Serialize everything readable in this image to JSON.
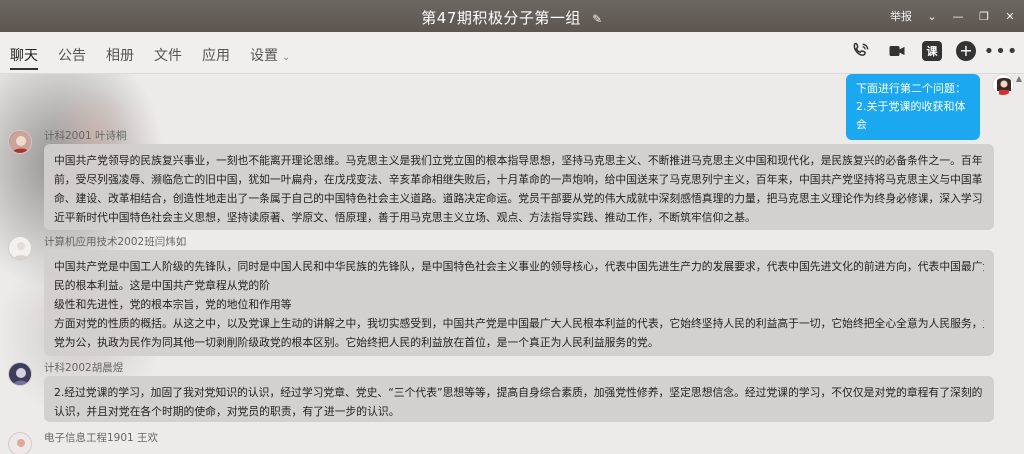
{
  "window": {
    "title": "第47期积极分子第一组",
    "report_label": "举报"
  },
  "tabs": [
    {
      "label": "聊天"
    },
    {
      "label": "公告"
    },
    {
      "label": "相册"
    },
    {
      "label": "文件"
    },
    {
      "label": "应用"
    },
    {
      "label": "设置"
    }
  ],
  "toolbar_icons": {
    "call": "phone-icon",
    "video": "video-camera-icon",
    "course": "课",
    "add": "+",
    "more": "more-icon"
  },
  "colors": {
    "titlebar": "#625b55",
    "bubble_mine": "#1ba8f0",
    "bubble_other": "#d2d0ce"
  },
  "my_message": {
    "lines": [
      "下面进行第二个问题：",
      "2.关于党课的收获和体会"
    ]
  },
  "messages": [
    {
      "sender": "计科2001 叶诗桐",
      "lines": [
        "中国共产党领导的民族复兴事业，一刻也不能离开理论思维。马克思主义是我们立党立国的根本指导思想，坚持马克思主义、不断推进马克思主义中国和现代化，是民族复兴的必备条件之一。百年",
        "前，受尽列强凌辱、濒临危亡的旧中国，犹如一叶扁舟，在戊戌变法、辛亥革命相继失败后，十月革命的一声炮响，给中国送来了马克思列宁主义，百年来，中国共产党坚持将马克思主义与中国革",
        "命、建设、改革相结合，创造性地走出了一条属于自己的中国特色社会主义道路。道路决定命运。党员干部要从党的伟大成就中深刻感悟真理的力量，把马克思主义理论作为终身必修课，深入学习习",
        "近平新时代中国特色社会主义思想，坚持读原著、学原文、悟原理，善于用马克思主义立场、观点、方法指导实践、推动工作，不断筑牢信仰之基。"
      ]
    },
    {
      "sender": "计算机应用技术2002班闫炜如",
      "lines": [
        "中国共产党是中国工人阶级的先锋队，同时是中国人民和中华民族的先锋队，是中国特色社会主义事业的领导核心，代表中国先进生产力的发展要求，代表中国先进文化的前进方向，代表中国最广大人",
        "民的根本利益。这是中国共产党章程从党的阶",
        "级性和先进性，党的根本宗旨，党的地位和作用等",
        "方面对党的性质的概括。从这之中，以及党课上生动的讲解之中，我切实感受到，中国共产党是中国最广大人民根本利益的代表，它始终坚持人民的利益高于一切，它始终把全心全意为人民服务，立",
        "党为公，执政为民作为同其他一切剥削阶级政党的根本区别。它始终把人民的利益放在首位，是一个真正为人民利益服务的党。"
      ]
    },
    {
      "sender": "计科2002胡晨煜",
      "lines": [
        "2.经过党课的学习，加固了我对党知识的认识，经过学习党章、党史、“三个代表”思想等等，提高自身综合素质，加强党性修养，坚定思想信念。经过党课的学习，不仅仅是对党的章程有了深刻的",
        "认识，并且对党在各个时期的使命，对党员的职责，有了进一步的认识。"
      ]
    },
    {
      "sender": "电子信息工程1901   王欢",
      "lines": []
    }
  ]
}
